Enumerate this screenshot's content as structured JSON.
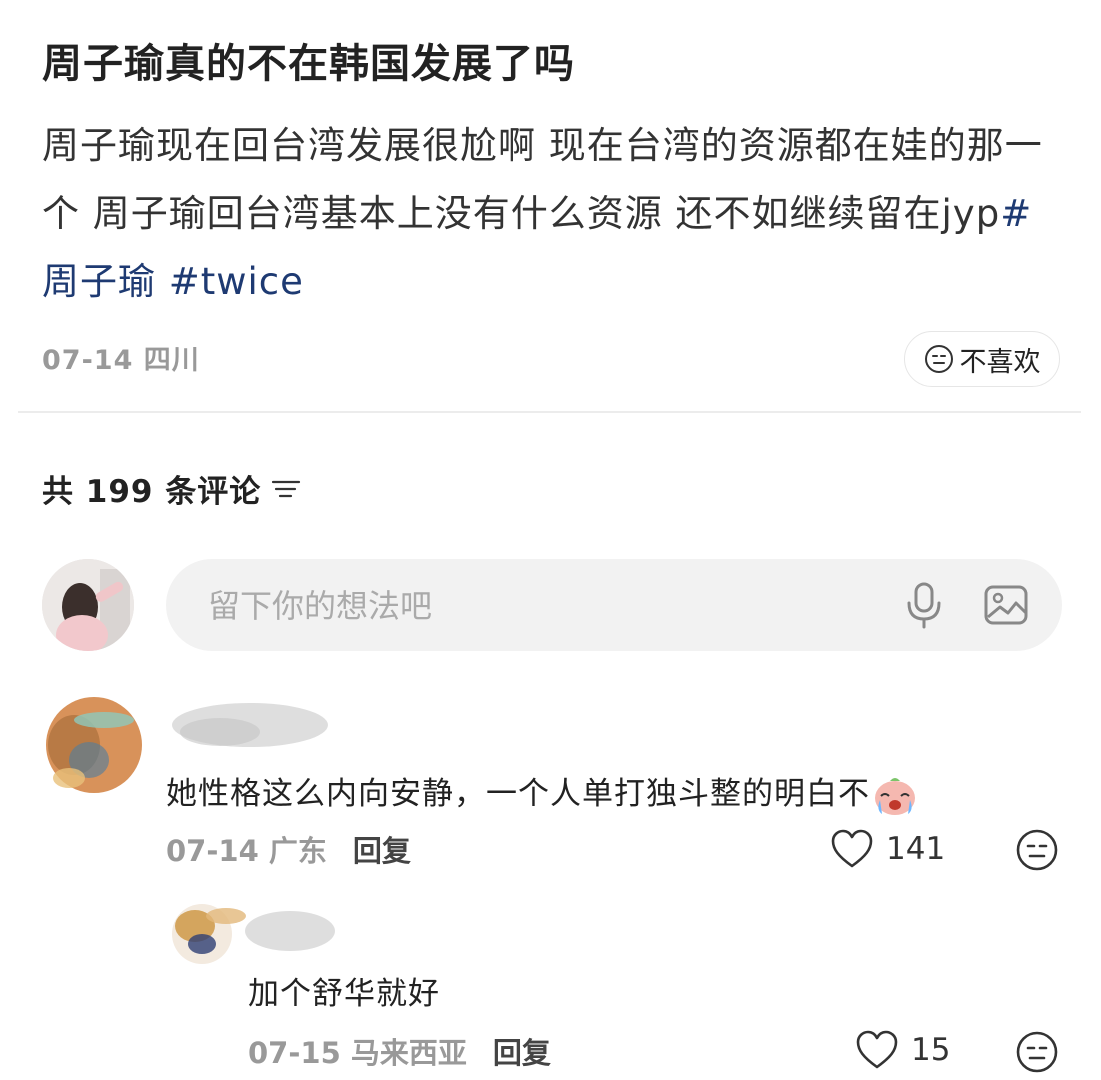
{
  "post": {
    "title": "周子瑜真的不在韩国发展了吗",
    "body": "周子瑜现在回台湾发展很尬啊 现在台湾的资源都在娃的那一个 周子瑜回台湾基本上没有什么资源 还不如继续留在jyp",
    "tags": [
      "#周子瑜",
      " #twice"
    ],
    "date": "07-14",
    "location": "四川",
    "dislike_label": "不喜欢"
  },
  "comments_header": {
    "prefix": "共",
    "count": "199",
    "suffix": "条评论"
  },
  "comment_box": {
    "placeholder": "留下你的想法吧"
  },
  "comments": [
    {
      "text": "她性格这么内向安静，一个人单打独斗整的明白不",
      "date": "07-14",
      "location": "广东",
      "reply_label": "回复",
      "likes": "141"
    },
    {
      "text": "加个舒华就好",
      "date": "07-15",
      "location": "马来西亚",
      "reply_label": "回复",
      "likes": "15"
    }
  ],
  "colors": {
    "tag": "#1e3a72",
    "meta": "#999999",
    "input_bg": "#f2f2f2"
  }
}
